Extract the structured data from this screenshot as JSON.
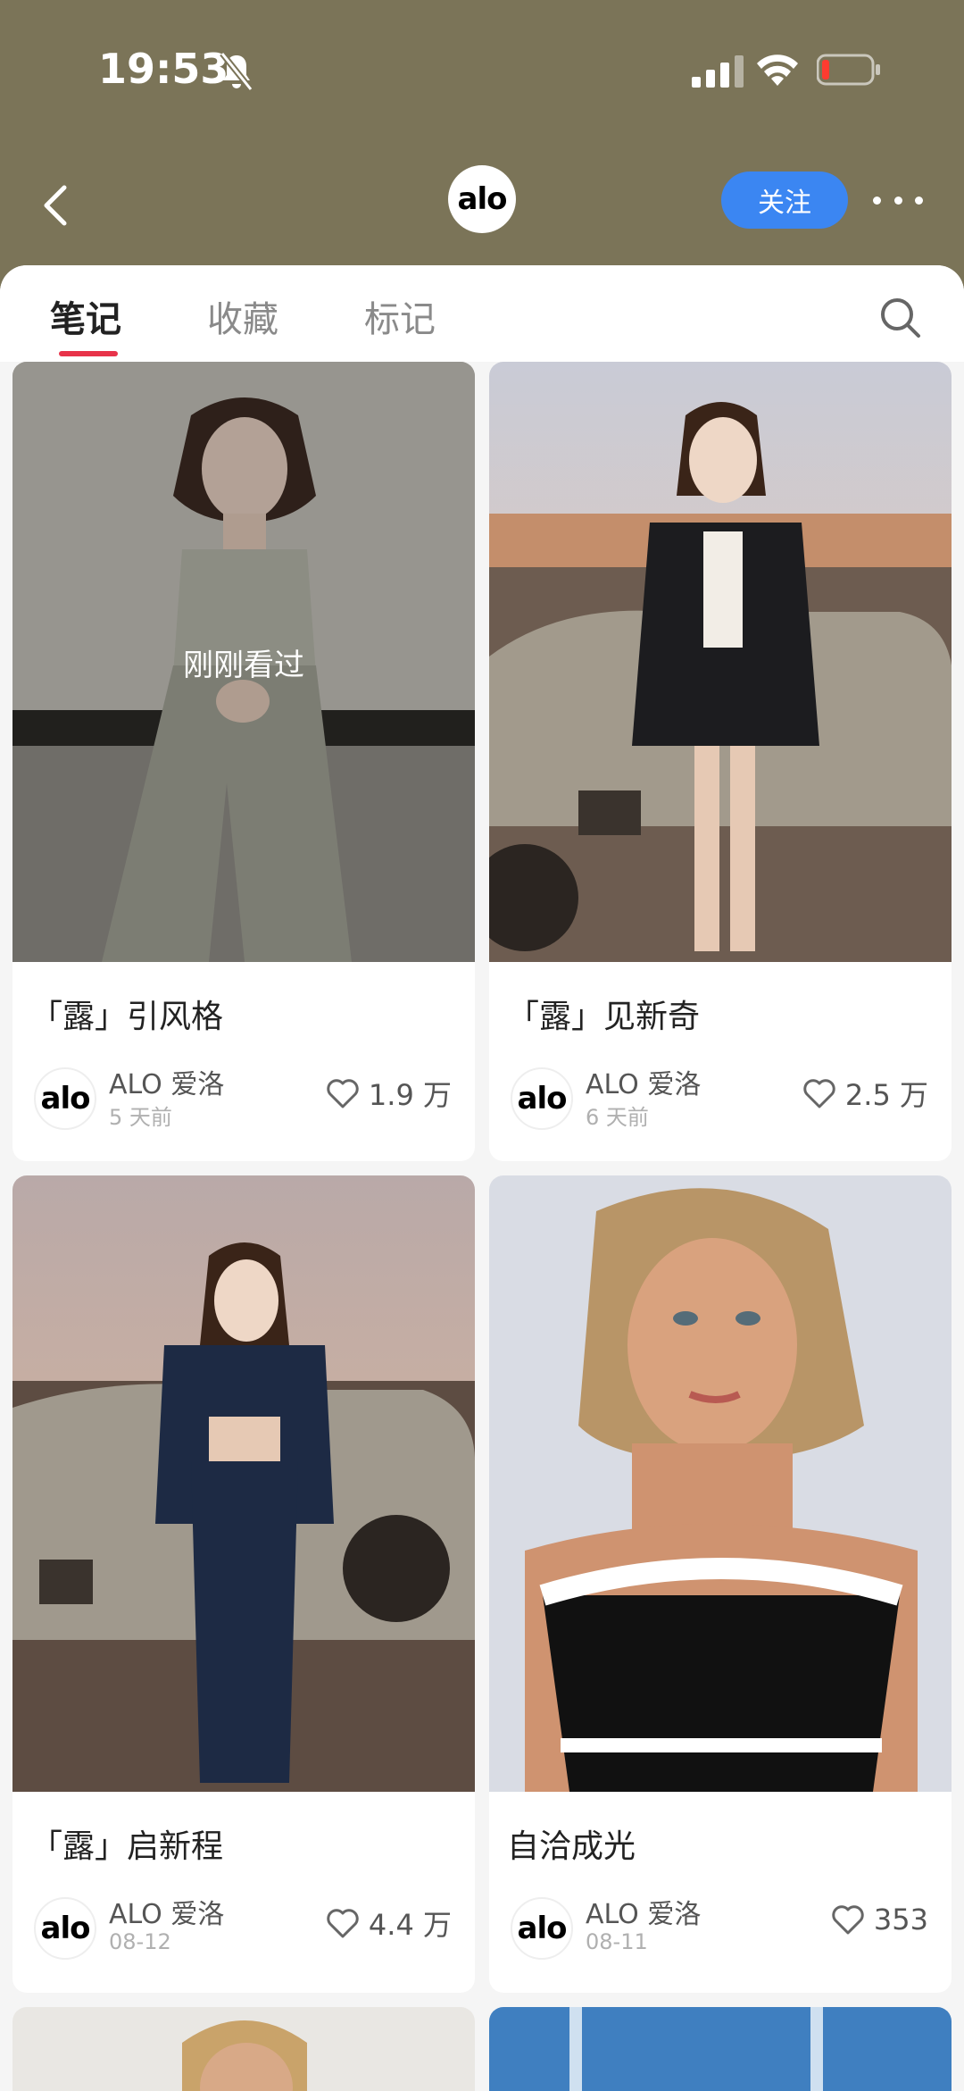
{
  "status_bar": {
    "time": "19:53"
  },
  "header": {
    "avatar_text": "alo",
    "follow_label": "关注"
  },
  "tabs": [
    {
      "label": "笔记",
      "active": true
    },
    {
      "label": "收藏",
      "active": false
    },
    {
      "label": "标记",
      "active": false
    }
  ],
  "posts": [
    {
      "title": "「露」引风格",
      "author": "ALO 爱洛",
      "date": "5 天前",
      "likes": "1.9 万",
      "overlay": "刚刚看过",
      "avatar_text": "alo"
    },
    {
      "title": "「露」见新奇",
      "author": "ALO 爱洛",
      "date": "6 天前",
      "likes": "2.5 万",
      "avatar_text": "alo"
    },
    {
      "title": "「露」启新程",
      "author": "ALO 爱洛",
      "date": "08-12",
      "likes": "4.4 万",
      "avatar_text": "alo"
    },
    {
      "title": "自洽成光",
      "author": "ALO 爱洛",
      "date": "08-11",
      "likes": "353",
      "avatar_text": "alo"
    }
  ],
  "colors": {
    "header_bg": "#7b7458",
    "accent_follow": "#3b86f2",
    "tab_indicator": "#e8334a"
  }
}
